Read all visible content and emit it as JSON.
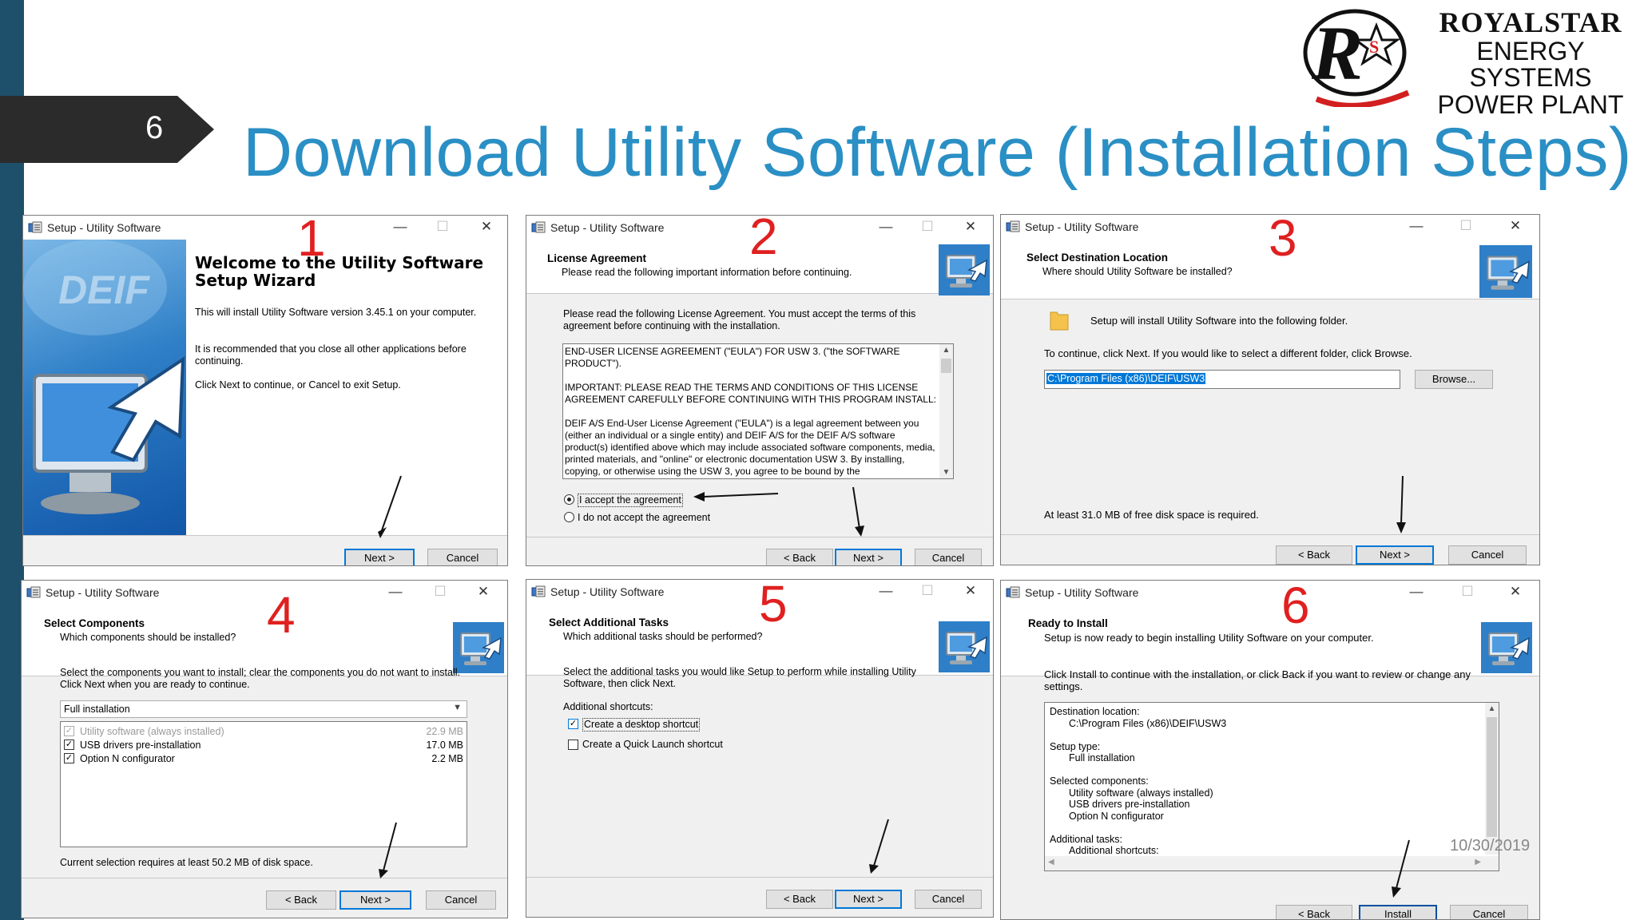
{
  "slide": {
    "number": "6",
    "title": "Download Utility Software (Installation Steps)",
    "date": "10/30/2019"
  },
  "logo": {
    "line1": "ROYALSTAR",
    "line2": "ENERGY SYSTEMS",
    "line3": "POWER PLANT",
    "mark_letters": "RS"
  },
  "common": {
    "window_title": "Setup - Utility Software",
    "minimize": "—",
    "maximize": "☐",
    "close": "✕",
    "back": "< Back",
    "next": "Next >",
    "cancel": "Cancel",
    "install": "Install"
  },
  "step1": {
    "num": "1",
    "sidebar_logo": "DEIF",
    "heading_line1": "Welcome to the Utility Software",
    "heading_line2": "Setup Wizard",
    "p1": "This will install Utility Software version 3.45.1 on your computer.",
    "p2": "It is recommended that you close all other applications before continuing.",
    "p3": "Click Next to continue, or Cancel to exit Setup."
  },
  "step2": {
    "num": "2",
    "header_title": "License Agreement",
    "header_sub": "Please read the following important information before continuing.",
    "intro": "Please read the following License Agreement. You must accept the terms of this agreement before continuing with the installation.",
    "license_p1": "END-USER LICENSE AGREEMENT (\"EULA\") FOR USW 3. (\"the SOFTWARE PRODUCT\").",
    "license_p2": "IMPORTANT: PLEASE READ THE TERMS AND CONDITIONS OF THIS LICENSE AGREEMENT CAREFULLY BEFORE CONTINUING WITH THIS PROGRAM INSTALL:",
    "license_p3": "DEIF A/S End-User License Agreement (\"EULA\") is a legal agreement between you (either an individual or a single entity) and DEIF A/S for the DEIF A/S software product(s) identified above which may include associated software components, media, printed materials, and \"online\" or electronic documentation USW 3. By installing, copying, or otherwise using the USW 3, you agree to be bound by the",
    "accept": "I accept the agreement",
    "decline": "I do not accept the agreement"
  },
  "step3": {
    "num": "3",
    "header_title": "Select Destination Location",
    "header_sub": "Where should Utility Software be installed?",
    "line1": "Setup will install Utility Software into the following folder.",
    "line2": "To continue, click Next. If you would like to select a different folder, click Browse.",
    "path_value": "C:\\Program Files (x86)\\DEIF\\USW3",
    "browse": "Browse...",
    "space": "At least 31.0 MB of free disk space is required."
  },
  "step4": {
    "num": "4",
    "header_title": "Select Components",
    "header_sub": "Which components should be installed?",
    "intro": "Select the components you want to install; clear the components you do not want to install. Click Next when you are ready to continue.",
    "dropdown": "Full installation",
    "components": [
      {
        "label": "Utility software (always installed)",
        "size": "22.9 MB"
      },
      {
        "label": "USB drivers pre-installation",
        "size": "17.0 MB"
      },
      {
        "label": "Option N configurator",
        "size": "2.2 MB"
      }
    ],
    "requirement": "Current selection requires at least 50.2 MB of disk space."
  },
  "step5": {
    "num": "5",
    "header_title": "Select Additional Tasks",
    "header_sub": "Which additional tasks should be performed?",
    "intro": "Select the additional tasks you would like Setup to perform while installing Utility Software, then click Next.",
    "group": "Additional shortcuts:",
    "task1": "Create a desktop shortcut",
    "task2": "Create a Quick Launch shortcut"
  },
  "step6": {
    "num": "6",
    "header_title": "Ready to Install",
    "header_sub": "Setup is now ready to begin installing Utility Software on your computer.",
    "intro": "Click Install to continue with the installation, or click Back if you want to review or change any settings.",
    "lines": [
      {
        "text": "Destination location:",
        "indent": false
      },
      {
        "text": "C:\\Program Files (x86)\\DEIF\\USW3",
        "indent": true
      },
      {
        "text": "",
        "indent": false
      },
      {
        "text": "Setup type:",
        "indent": false
      },
      {
        "text": "Full installation",
        "indent": true
      },
      {
        "text": "",
        "indent": false
      },
      {
        "text": "Selected components:",
        "indent": false
      },
      {
        "text": "Utility software (always installed)",
        "indent": true
      },
      {
        "text": "USB drivers pre-installation",
        "indent": true
      },
      {
        "text": "Option N configurator",
        "indent": true
      },
      {
        "text": "",
        "indent": false
      },
      {
        "text": "Additional tasks:",
        "indent": false
      },
      {
        "text": "Additional shortcuts:",
        "indent": true
      }
    ]
  }
}
